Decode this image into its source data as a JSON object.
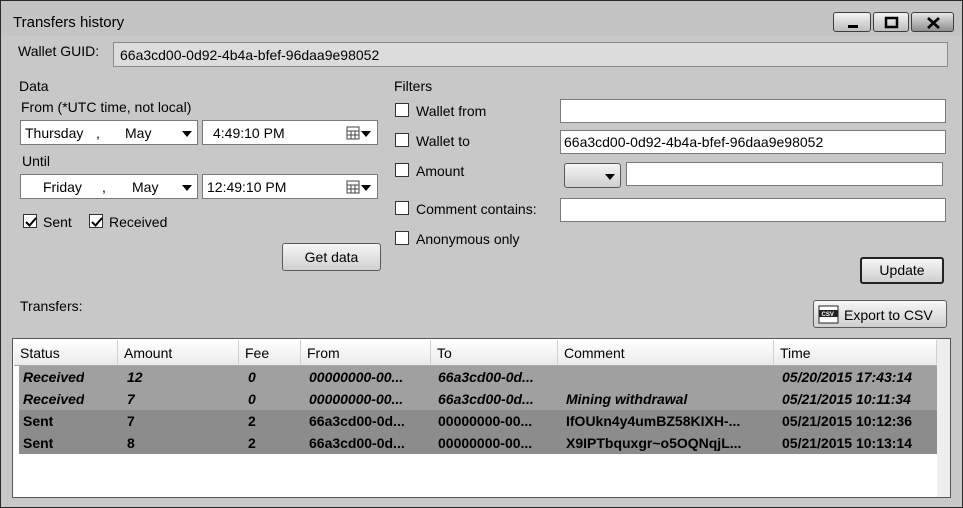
{
  "window": {
    "title": "Transfers history"
  },
  "wallet": {
    "label": "Wallet GUID:",
    "guid": "66a3cd00-0d92-4b4a-bfef-96daa9e98052"
  },
  "data_section": {
    "header": "Data",
    "from_label": "From (*UTC time, not local)",
    "from": {
      "weekday": "Thursday",
      "sep": ",",
      "month": "May",
      "time": "4:49:10 PM"
    },
    "until_label": "Until",
    "until": {
      "weekday": "Friday",
      "sep": ",",
      "month": "May",
      "time": "12:49:10 PM"
    },
    "sent_label": "Sent",
    "sent_checked": true,
    "received_label": "Received",
    "received_checked": true,
    "get_data_label": "Get data"
  },
  "filters": {
    "header": "Filters",
    "wallet_from": {
      "label": "Wallet from",
      "checked": false,
      "value": ""
    },
    "wallet_to": {
      "label": "Wallet to",
      "checked": false,
      "value": "66a3cd00-0d92-4b4a-bfef-96daa9e98052"
    },
    "amount": {
      "label": "Amount",
      "checked": false,
      "operator": "",
      "value": ""
    },
    "comment": {
      "label": "Comment contains:",
      "checked": false,
      "value": ""
    },
    "anonymous": {
      "label": "Anonymous only",
      "checked": false
    },
    "update_label": "Update"
  },
  "transfers": {
    "label": "Transfers:",
    "export_label": "Export to CSV",
    "export_icon": "csv-file-icon",
    "columns": [
      "Status",
      "Amount",
      "Fee",
      "From",
      "To",
      "Comment",
      "Time"
    ],
    "rows": [
      {
        "status": "Received",
        "amount": "12",
        "fee": "0",
        "from": "00000000-00...",
        "to": "66a3cd00-0d...",
        "comment": "",
        "time": "05/20/2015 17:43:14"
      },
      {
        "status": "Received",
        "amount": "7",
        "fee": "0",
        "from": "00000000-00...",
        "to": "66a3cd00-0d...",
        "comment": "Mining withdrawal",
        "time": "05/21/2015 10:11:34"
      },
      {
        "status": "Sent",
        "amount": "7",
        "fee": "2",
        "from": "66a3cd00-0d...",
        "to": "00000000-00...",
        "comment": "IfOUkn4y4umBZ58KIXH-...",
        "time": "05/21/2015 10:12:36"
      },
      {
        "status": "Sent",
        "amount": "8",
        "fee": "2",
        "from": "66a3cd00-0d...",
        "to": "00000000-00...",
        "comment": "X9IPTbquxgr~o5OQNqjL...",
        "time": "05/21/2015 10:13:14"
      }
    ]
  }
}
